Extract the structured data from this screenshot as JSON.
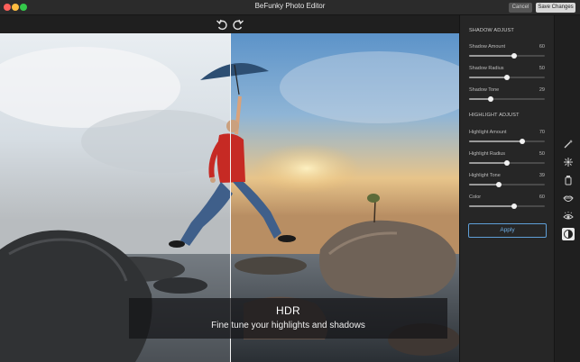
{
  "window": {
    "title": "BeFunky Photo Editor"
  },
  "header": {
    "cancel_label": "Cancel",
    "save_label": "Save Changes"
  },
  "canvas": {
    "caption": {
      "title": "HDR",
      "subtitle": "Fine tune your highlights and shadows"
    }
  },
  "panel": {
    "shadow_section": "SHADOW ADJUST",
    "shadow_sliders": [
      {
        "label": "Shadow Amount",
        "value": "60"
      },
      {
        "label": "Shadow Radius",
        "value": "50"
      },
      {
        "label": "Shadow Tone",
        "value": "29"
      }
    ],
    "highlight_section": "HIGHLIGHT ADJUST",
    "highlight_sliders": [
      {
        "label": "Highlight Amount",
        "value": "70"
      },
      {
        "label": "Highlight Radius",
        "value": "50"
      },
      {
        "label": "Highlight Tone",
        "value": "39"
      },
      {
        "label": "Color",
        "value": "60"
      }
    ],
    "apply_label": "Apply"
  },
  "tools": [
    "magic-wand-icon",
    "sparkle-icon",
    "tube-icon",
    "lips-icon",
    "eye-icon",
    "contrast-icon"
  ]
}
